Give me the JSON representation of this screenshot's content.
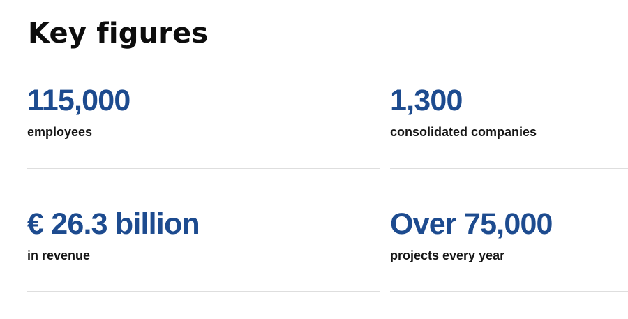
{
  "title": "Key figures",
  "figures": [
    {
      "value": "115,000",
      "label": "employees"
    },
    {
      "value": "1,300",
      "label": "consolidated companies"
    },
    {
      "value": "€ 26.3 billion",
      "label": "in revenue"
    },
    {
      "value": "Over 75,000",
      "label": "projects every year"
    }
  ],
  "colors": {
    "accent": "#1d4b8f",
    "text": "#151515",
    "divider": "#dedede"
  }
}
